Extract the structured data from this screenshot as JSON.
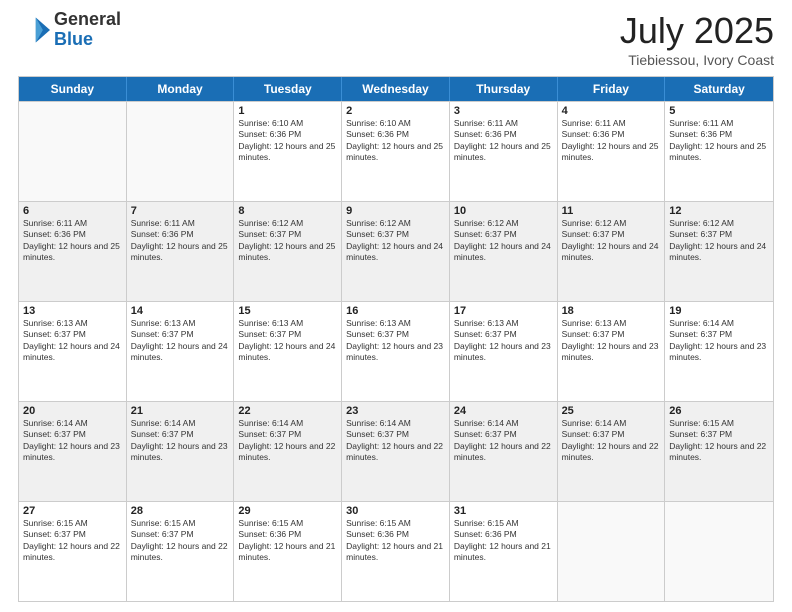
{
  "logo": {
    "general": "General",
    "blue": "Blue"
  },
  "header": {
    "month": "July 2025",
    "location": "Tiebiessou, Ivory Coast"
  },
  "weekdays": [
    "Sunday",
    "Monday",
    "Tuesday",
    "Wednesday",
    "Thursday",
    "Friday",
    "Saturday"
  ],
  "weeks": [
    {
      "alt": false,
      "days": [
        {
          "num": "",
          "info": ""
        },
        {
          "num": "",
          "info": ""
        },
        {
          "num": "1",
          "info": "Sunrise: 6:10 AM\nSunset: 6:36 PM\nDaylight: 12 hours and 25 minutes."
        },
        {
          "num": "2",
          "info": "Sunrise: 6:10 AM\nSunset: 6:36 PM\nDaylight: 12 hours and 25 minutes."
        },
        {
          "num": "3",
          "info": "Sunrise: 6:11 AM\nSunset: 6:36 PM\nDaylight: 12 hours and 25 minutes."
        },
        {
          "num": "4",
          "info": "Sunrise: 6:11 AM\nSunset: 6:36 PM\nDaylight: 12 hours and 25 minutes."
        },
        {
          "num": "5",
          "info": "Sunrise: 6:11 AM\nSunset: 6:36 PM\nDaylight: 12 hours and 25 minutes."
        }
      ]
    },
    {
      "alt": true,
      "days": [
        {
          "num": "6",
          "info": "Sunrise: 6:11 AM\nSunset: 6:36 PM\nDaylight: 12 hours and 25 minutes."
        },
        {
          "num": "7",
          "info": "Sunrise: 6:11 AM\nSunset: 6:36 PM\nDaylight: 12 hours and 25 minutes."
        },
        {
          "num": "8",
          "info": "Sunrise: 6:12 AM\nSunset: 6:37 PM\nDaylight: 12 hours and 25 minutes."
        },
        {
          "num": "9",
          "info": "Sunrise: 6:12 AM\nSunset: 6:37 PM\nDaylight: 12 hours and 24 minutes."
        },
        {
          "num": "10",
          "info": "Sunrise: 6:12 AM\nSunset: 6:37 PM\nDaylight: 12 hours and 24 minutes."
        },
        {
          "num": "11",
          "info": "Sunrise: 6:12 AM\nSunset: 6:37 PM\nDaylight: 12 hours and 24 minutes."
        },
        {
          "num": "12",
          "info": "Sunrise: 6:12 AM\nSunset: 6:37 PM\nDaylight: 12 hours and 24 minutes."
        }
      ]
    },
    {
      "alt": false,
      "days": [
        {
          "num": "13",
          "info": "Sunrise: 6:13 AM\nSunset: 6:37 PM\nDaylight: 12 hours and 24 minutes."
        },
        {
          "num": "14",
          "info": "Sunrise: 6:13 AM\nSunset: 6:37 PM\nDaylight: 12 hours and 24 minutes."
        },
        {
          "num": "15",
          "info": "Sunrise: 6:13 AM\nSunset: 6:37 PM\nDaylight: 12 hours and 24 minutes."
        },
        {
          "num": "16",
          "info": "Sunrise: 6:13 AM\nSunset: 6:37 PM\nDaylight: 12 hours and 23 minutes."
        },
        {
          "num": "17",
          "info": "Sunrise: 6:13 AM\nSunset: 6:37 PM\nDaylight: 12 hours and 23 minutes."
        },
        {
          "num": "18",
          "info": "Sunrise: 6:13 AM\nSunset: 6:37 PM\nDaylight: 12 hours and 23 minutes."
        },
        {
          "num": "19",
          "info": "Sunrise: 6:14 AM\nSunset: 6:37 PM\nDaylight: 12 hours and 23 minutes."
        }
      ]
    },
    {
      "alt": true,
      "days": [
        {
          "num": "20",
          "info": "Sunrise: 6:14 AM\nSunset: 6:37 PM\nDaylight: 12 hours and 23 minutes."
        },
        {
          "num": "21",
          "info": "Sunrise: 6:14 AM\nSunset: 6:37 PM\nDaylight: 12 hours and 23 minutes."
        },
        {
          "num": "22",
          "info": "Sunrise: 6:14 AM\nSunset: 6:37 PM\nDaylight: 12 hours and 22 minutes."
        },
        {
          "num": "23",
          "info": "Sunrise: 6:14 AM\nSunset: 6:37 PM\nDaylight: 12 hours and 22 minutes."
        },
        {
          "num": "24",
          "info": "Sunrise: 6:14 AM\nSunset: 6:37 PM\nDaylight: 12 hours and 22 minutes."
        },
        {
          "num": "25",
          "info": "Sunrise: 6:14 AM\nSunset: 6:37 PM\nDaylight: 12 hours and 22 minutes."
        },
        {
          "num": "26",
          "info": "Sunrise: 6:15 AM\nSunset: 6:37 PM\nDaylight: 12 hours and 22 minutes."
        }
      ]
    },
    {
      "alt": false,
      "days": [
        {
          "num": "27",
          "info": "Sunrise: 6:15 AM\nSunset: 6:37 PM\nDaylight: 12 hours and 22 minutes."
        },
        {
          "num": "28",
          "info": "Sunrise: 6:15 AM\nSunset: 6:37 PM\nDaylight: 12 hours and 22 minutes."
        },
        {
          "num": "29",
          "info": "Sunrise: 6:15 AM\nSunset: 6:36 PM\nDaylight: 12 hours and 21 minutes."
        },
        {
          "num": "30",
          "info": "Sunrise: 6:15 AM\nSunset: 6:36 PM\nDaylight: 12 hours and 21 minutes."
        },
        {
          "num": "31",
          "info": "Sunrise: 6:15 AM\nSunset: 6:36 PM\nDaylight: 12 hours and 21 minutes."
        },
        {
          "num": "",
          "info": ""
        },
        {
          "num": "",
          "info": ""
        }
      ]
    }
  ]
}
